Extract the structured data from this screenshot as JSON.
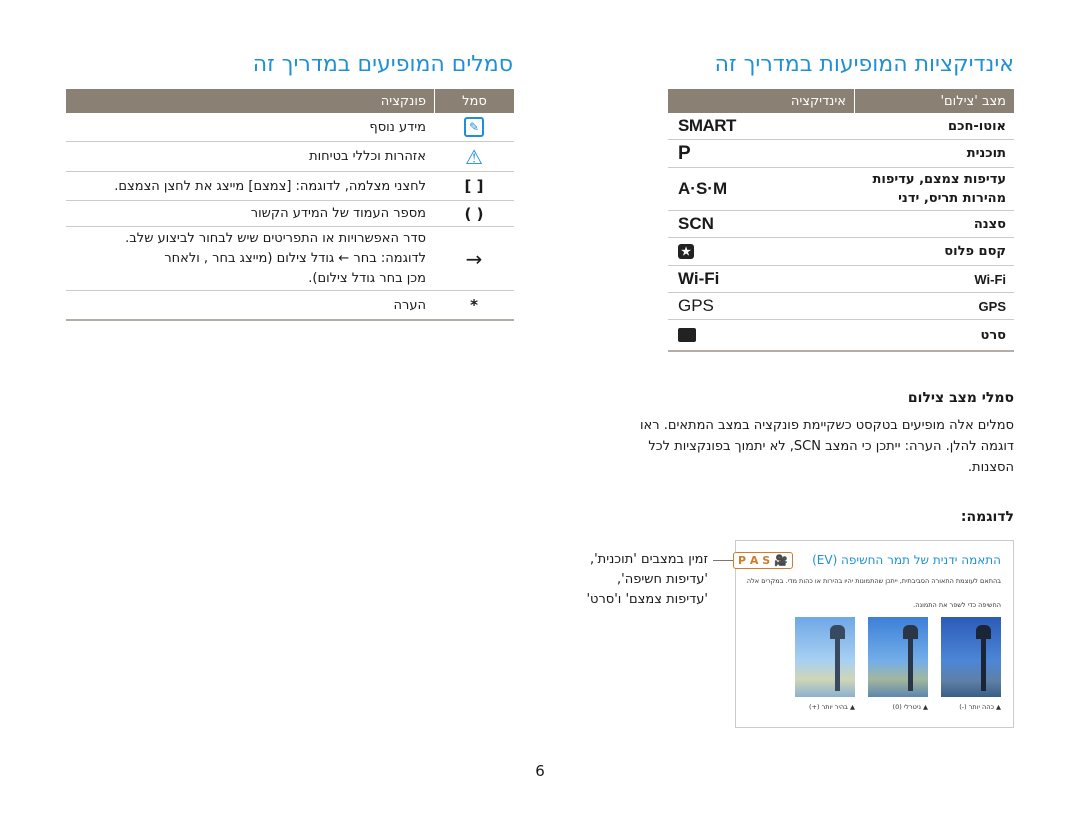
{
  "right_title": "אינדיקציות המופיעות במדריך זה",
  "left_title": "סמלים המופיעים במדריך זה",
  "right_table": {
    "head_mode": "מצב 'צילום'",
    "head_indicator": "אינדיקציה",
    "rows": [
      {
        "mode": "אוטו-חכם",
        "indicator": "SMART"
      },
      {
        "mode": "תוכנית",
        "indicator": "P"
      },
      {
        "mode": "עדיפות צמצם, עדיפות",
        "mode2": "מהירות תריס, ידני",
        "indicator": "A·S·M"
      },
      {
        "mode": "סצנה",
        "indicator": "SCN"
      },
      {
        "mode": "קסם פלוס",
        "indicator": "★"
      },
      {
        "mode": "Wi-Fi",
        "indicator": "Wi-Fi"
      },
      {
        "mode": "GPS",
        "indicator": "GPS"
      },
      {
        "mode": "סרט",
        "indicator": "🎥"
      }
    ]
  },
  "left_table": {
    "head_symbol": "סמל",
    "head_function": "פונקציה",
    "rows": [
      {
        "symbol": "✎",
        "desc": "מידע נוסף"
      },
      {
        "symbol": "⚠",
        "desc": "אזהרות וכללי בטיחות"
      },
      {
        "symbol": "[  ]",
        "desc": "לחצני מצלמה, לדוגמה: [צמצם] מייצג את לחצן הצמצם."
      },
      {
        "symbol": "(  )",
        "desc": "מספר העמוד של המידע הקשור"
      },
      {
        "symbol": "→",
        "desc": "סדר האפשרויות או התפריטים שיש לבחור לביצוע שלב.",
        "desc2": "לדוגמה: בחר  ← גודל צילום (מייצג בחר , ולאחר",
        "desc3": "מכן בחר גודל צילום)."
      },
      {
        "symbol": "*",
        "desc": "הערה"
      }
    ]
  },
  "mode_icons_heading": "סמלי מצב צילום",
  "mode_icons_para": [
    "סמלים אלה מופיעים בטקסט כשקיימת פונקציה במצב המתאים. ראו",
    "דוגמה להלן. הערה: ייתכן כי המצב SCN,  לא יתמוך בפונקציות לכל",
    "הסצנות."
  ],
  "example_heading": "לדוגמה:",
  "example_caption_title": "התאמה ידנית של תמר החשיפה (EV)",
  "example_badge": "P A S 🎥",
  "example_right_lines": [
    "זמין במצבים 'תוכנית',",
    "'עדיפות חשיפה',",
    "'עדיפות צמצם' ו'סרט'"
  ],
  "example_small_lines": [
    "בהתאם לעוצמת התאורה הסביבתית, ייתכן שהתמונות יהיו בהירות או כהות מדי. במקרים אלה, ניתן להתאים את ערך",
    "החשיפה כדי לשפר את התמונה."
  ],
  "photo_labels": [
    "▲ כהה יותר (-)",
    "▲ ניטרלי (0)",
    "▲ בהיר יותר (+)"
  ],
  "page_number": "6"
}
